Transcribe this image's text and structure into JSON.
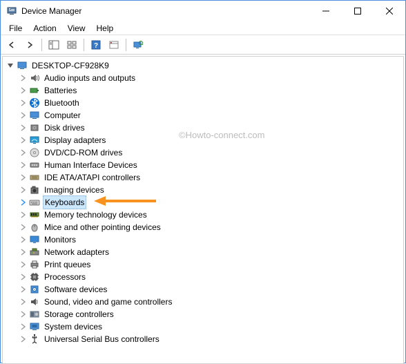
{
  "window": {
    "title": "Device Manager"
  },
  "menus": {
    "file": "File",
    "action": "Action",
    "view": "View",
    "help": "Help"
  },
  "root": {
    "name": "DESKTOP-CF928K9"
  },
  "categories": [
    {
      "label": "Audio inputs and outputs",
      "icon": "speaker-icon"
    },
    {
      "label": "Batteries",
      "icon": "battery-icon"
    },
    {
      "label": "Bluetooth",
      "icon": "bluetooth-icon"
    },
    {
      "label": "Computer",
      "icon": "computer-icon"
    },
    {
      "label": "Disk drives",
      "icon": "disk-icon"
    },
    {
      "label": "Display adapters",
      "icon": "display-icon"
    },
    {
      "label": "DVD/CD-ROM drives",
      "icon": "dvd-icon"
    },
    {
      "label": "Human Interface Devices",
      "icon": "hid-icon"
    },
    {
      "label": "IDE ATA/ATAPI controllers",
      "icon": "ide-icon"
    },
    {
      "label": "Imaging devices",
      "icon": "camera-icon"
    },
    {
      "label": "Keyboards",
      "icon": "keyboard-icon",
      "selected": true
    },
    {
      "label": "Memory technology devices",
      "icon": "memory-icon"
    },
    {
      "label": "Mice and other pointing devices",
      "icon": "mouse-icon"
    },
    {
      "label": "Monitors",
      "icon": "monitor-icon"
    },
    {
      "label": "Network adapters",
      "icon": "network-icon"
    },
    {
      "label": "Print queues",
      "icon": "printer-icon"
    },
    {
      "label": "Processors",
      "icon": "cpu-icon"
    },
    {
      "label": "Software devices",
      "icon": "software-icon"
    },
    {
      "label": "Sound, video and game controllers",
      "icon": "sound-icon"
    },
    {
      "label": "Storage controllers",
      "icon": "storage-icon"
    },
    {
      "label": "System devices",
      "icon": "system-icon"
    },
    {
      "label": "Universal Serial Bus controllers",
      "icon": "usb-icon"
    }
  ],
  "watermark": "©Howto-connect.com"
}
